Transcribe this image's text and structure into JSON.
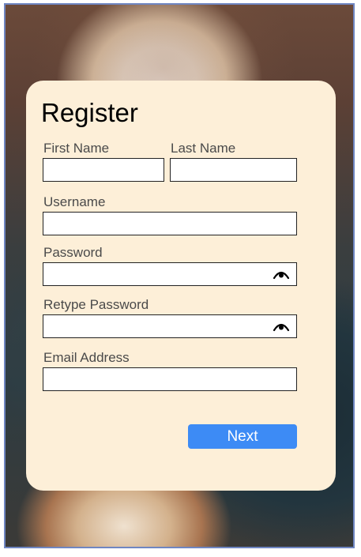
{
  "form": {
    "title": "Register",
    "first_name": {
      "label": "First Name",
      "value": ""
    },
    "last_name": {
      "label": "Last Name",
      "value": ""
    },
    "username": {
      "label": "Username",
      "value": ""
    },
    "password": {
      "label": "Password",
      "value": "",
      "toggle_icon": "eye-icon"
    },
    "retype_password": {
      "label": "Retype Password",
      "value": "",
      "toggle_icon": "eye-icon"
    },
    "email": {
      "label": "Email Address",
      "value": ""
    },
    "next_label": "Next"
  },
  "colors": {
    "card_background": "#fdefd8",
    "button_background": "#3d8bf5",
    "button_text": "#ffffff",
    "frame_border": "#6f86c2"
  }
}
